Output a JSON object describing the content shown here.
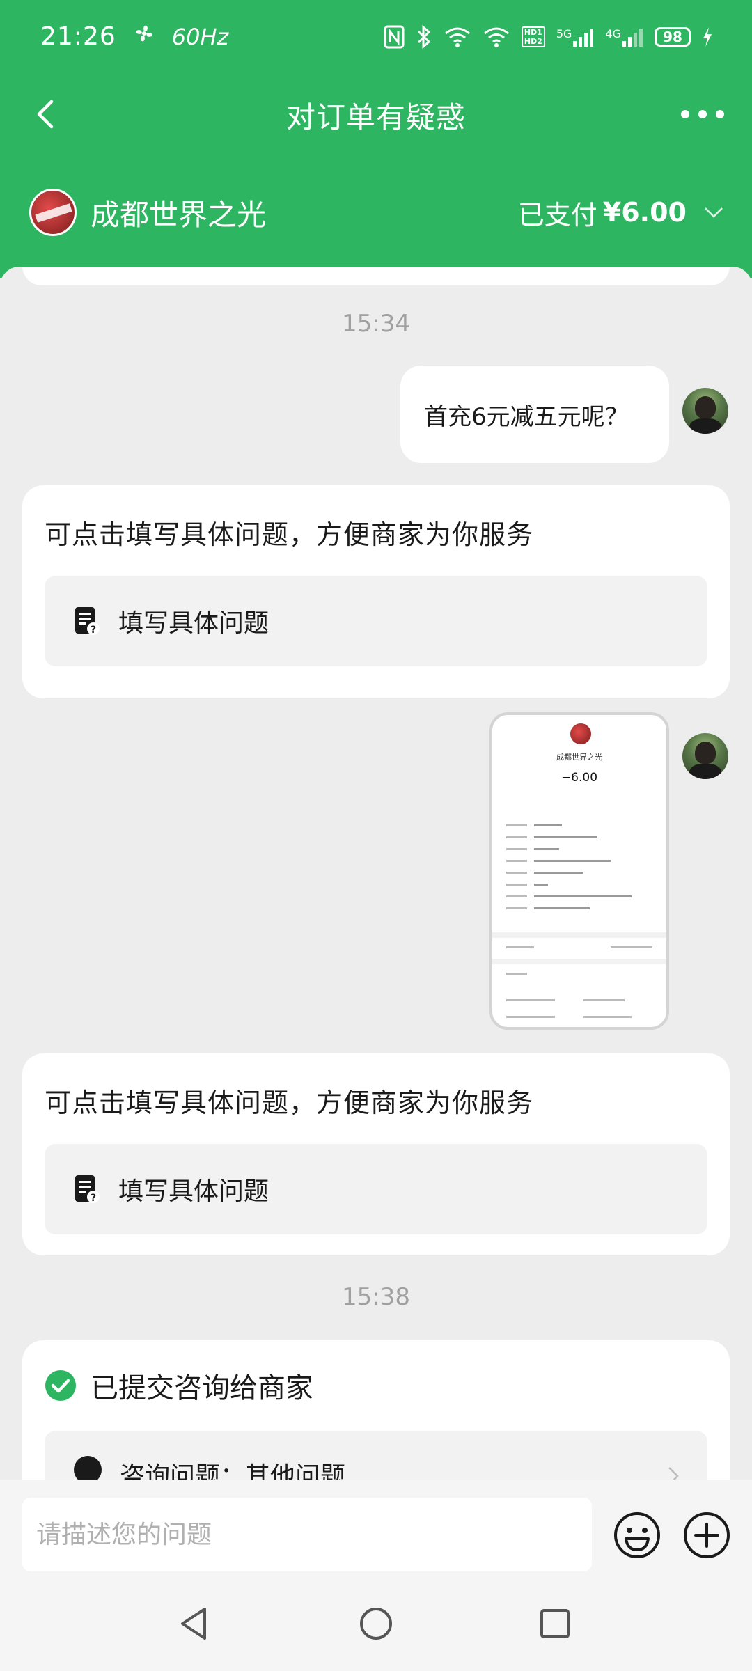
{
  "status_bar": {
    "time": "21:26",
    "refresh_rate": "60Hz",
    "signal_5g": "5G",
    "signal_4g": "4G",
    "hd_badge": "HD1 HD2",
    "battery": "98"
  },
  "header": {
    "title": "对订单有疑惑",
    "merchant_name": "成都世界之光",
    "paid_label": "已支付",
    "paid_amount": "¥6.00",
    "colors": {
      "primary": "#2eb561"
    }
  },
  "chat": {
    "timestamps": [
      "15:34",
      "15:38"
    ],
    "user_message": "首充6元减五元呢？",
    "prompt_cards": [
      {
        "text": "可点击填写具体问题，方便商家为你服务",
        "action": "填写具体问题"
      },
      {
        "text": "可点击填写具体问题，方便商家为你服务",
        "action": "填写具体问题"
      }
    ],
    "screenshot": {
      "merchant": "成都世界之光",
      "amount": "−6.00"
    },
    "submitted_card": {
      "title": "已提交咨询给商家",
      "subtitle": "咨询问题：其他问题"
    }
  },
  "composer": {
    "placeholder": "请描述您的问题"
  }
}
